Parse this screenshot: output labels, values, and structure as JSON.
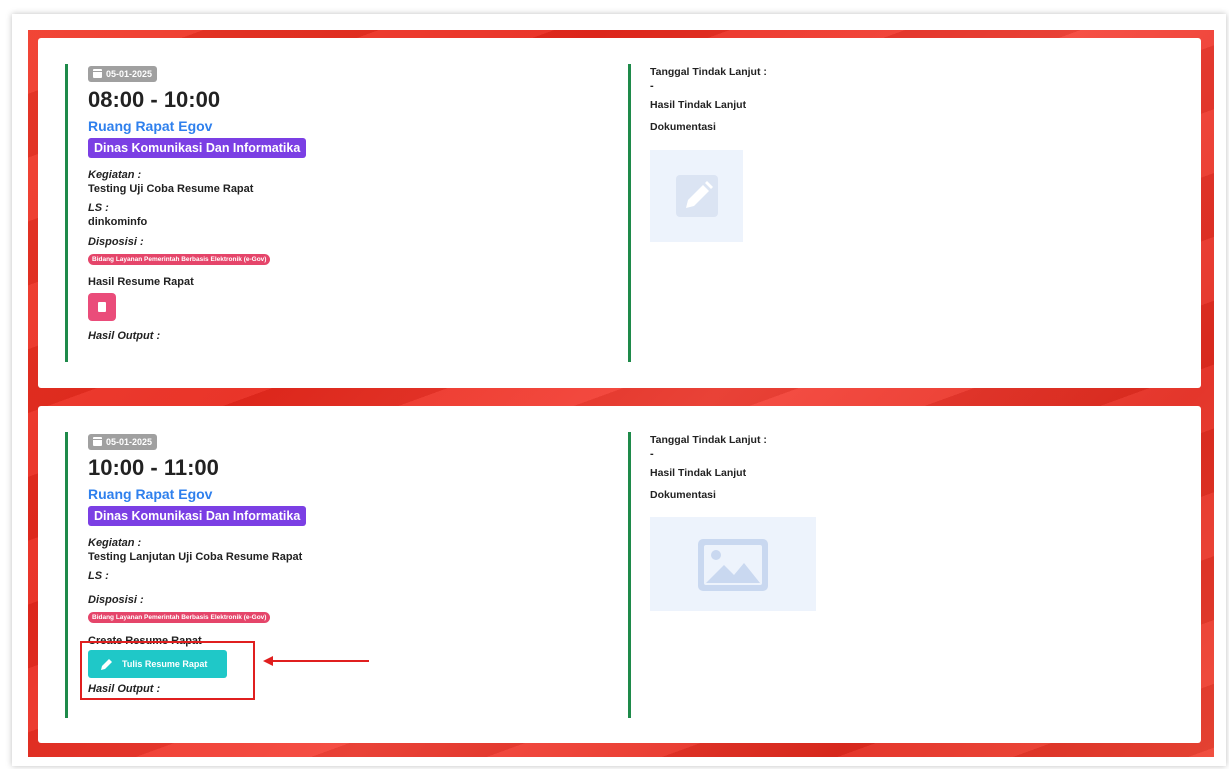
{
  "cards": [
    {
      "date": "05-01-2025",
      "time": "08:00 - 10:00",
      "room": "Ruang Rapat Egov",
      "org": "Dinas Komunikasi Dan Informatika",
      "kegiatan_label": "Kegiatan :",
      "kegiatan_value": "Testing Uji Coba Resume Rapat",
      "ls_label": "LS :",
      "ls_value": "dinkominfo",
      "disposisi_label": "Disposisi :",
      "disposisi_value": "Bidang Layanan Pemerintah Berbasis Elektronik (e-Gov)",
      "resume_label": "Hasil Resume Rapat",
      "output_label": "Hasil Output :",
      "tindak_lanjut_label": "Tanggal Tindak Lanjut :",
      "tindak_lanjut_value": "-",
      "hasil_tindak_label": "Hasil Tindak Lanjut",
      "dokumentasi_label": "Dokumentasi"
    },
    {
      "date": "05-01-2025",
      "time": "10:00 - 11:00",
      "room": "Ruang Rapat Egov",
      "org": "Dinas Komunikasi Dan Informatika",
      "kegiatan_label": "Kegiatan :",
      "kegiatan_value": "Testing Lanjutan Uji Coba Resume Rapat",
      "ls_label": "LS :",
      "disposisi_label": "Disposisi :",
      "disposisi_value": "Bidang Layanan Pemerintah Berbasis Elektronik (e-Gov)",
      "create_label": "Create Resume Rapat",
      "create_button": "Tulis Resume Rapat",
      "output_label": "Hasil Output :",
      "tindak_lanjut_label": "Tanggal Tindak Lanjut :",
      "tindak_lanjut_value": "-",
      "hasil_tindak_label": "Hasil Tindak Lanjut",
      "dokumentasi_label": "Dokumentasi"
    }
  ],
  "icons": {
    "calendar": "calendar-icon",
    "document": "document-icon",
    "pencil": "pencil-icon",
    "image": "image-placeholder-icon"
  },
  "colors": {
    "accent_green": "#1e8a4a",
    "org_badge": "#7b3fe4",
    "room_link": "#2f80ed",
    "disposisi_pill": "#e5456a",
    "tulis_button": "#1fc8c8",
    "annotation_red": "#e01f1f"
  }
}
